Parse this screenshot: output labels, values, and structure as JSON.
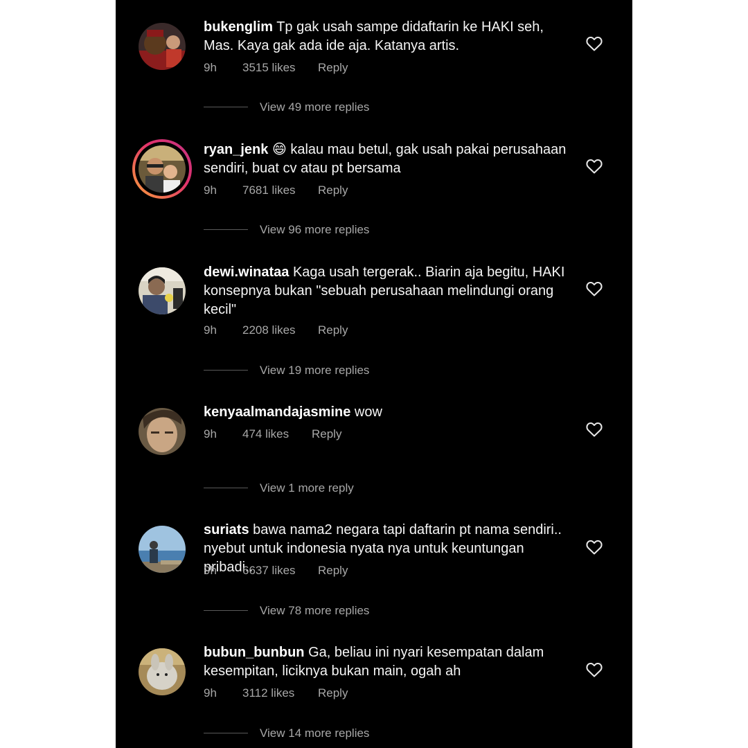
{
  "comments": [
    {
      "username": "bukenglim",
      "text": "Tp gak usah sampe didaftarin ke HAKI seh, Mas. Kaya gak ada ide aja. Katanya artis.",
      "time": "9h",
      "likes": "3515 likes",
      "reply": "Reply",
      "view_replies": "View 49 more replies"
    },
    {
      "username": "ryan_jenk",
      "text": "😄 kalau mau betul, gak usah pakai perusahaan sendiri, buat cv atau pt bersama",
      "time": "9h",
      "likes": "7681 likes",
      "reply": "Reply",
      "view_replies": "View 96 more replies"
    },
    {
      "username": "dewi.winataa",
      "text": "Kaga usah tergerak.. Biarin aja begitu, HAKI konsepnya bukan \"sebuah perusahaan melindungi orang kecil\"",
      "time": "9h",
      "likes": "2208 likes",
      "reply": "Reply",
      "view_replies": "View 19 more replies"
    },
    {
      "username": "kenyaalmandajasmine",
      "text": "wow",
      "time": "9h",
      "likes": "474 likes",
      "reply": "Reply",
      "view_replies": "View 1 more reply"
    },
    {
      "username": "suriats",
      "text": "bawa nama2 negara tapi daftarin pt nama sendiri.. nyebut untuk indonesia nyata nya untuk keuntungan pribadi..",
      "time": "9h",
      "likes": "6637 likes",
      "reply": "Reply",
      "view_replies": "View 78 more replies"
    },
    {
      "username": "bubun_bunbun",
      "text": "Ga, beliau ini nyari kesempatan dalam kesempitan, liciknya bukan main, ogah ah",
      "time": "9h",
      "likes": "3112 likes",
      "reply": "Reply",
      "view_replies": "View 14 more replies"
    }
  ],
  "icons": {
    "like": "heart-outline-icon"
  },
  "colors": {
    "background": "#000000",
    "text": "#f5f5f5",
    "secondary_text": "#a8a8a8",
    "story_ring": "#e1306c"
  }
}
